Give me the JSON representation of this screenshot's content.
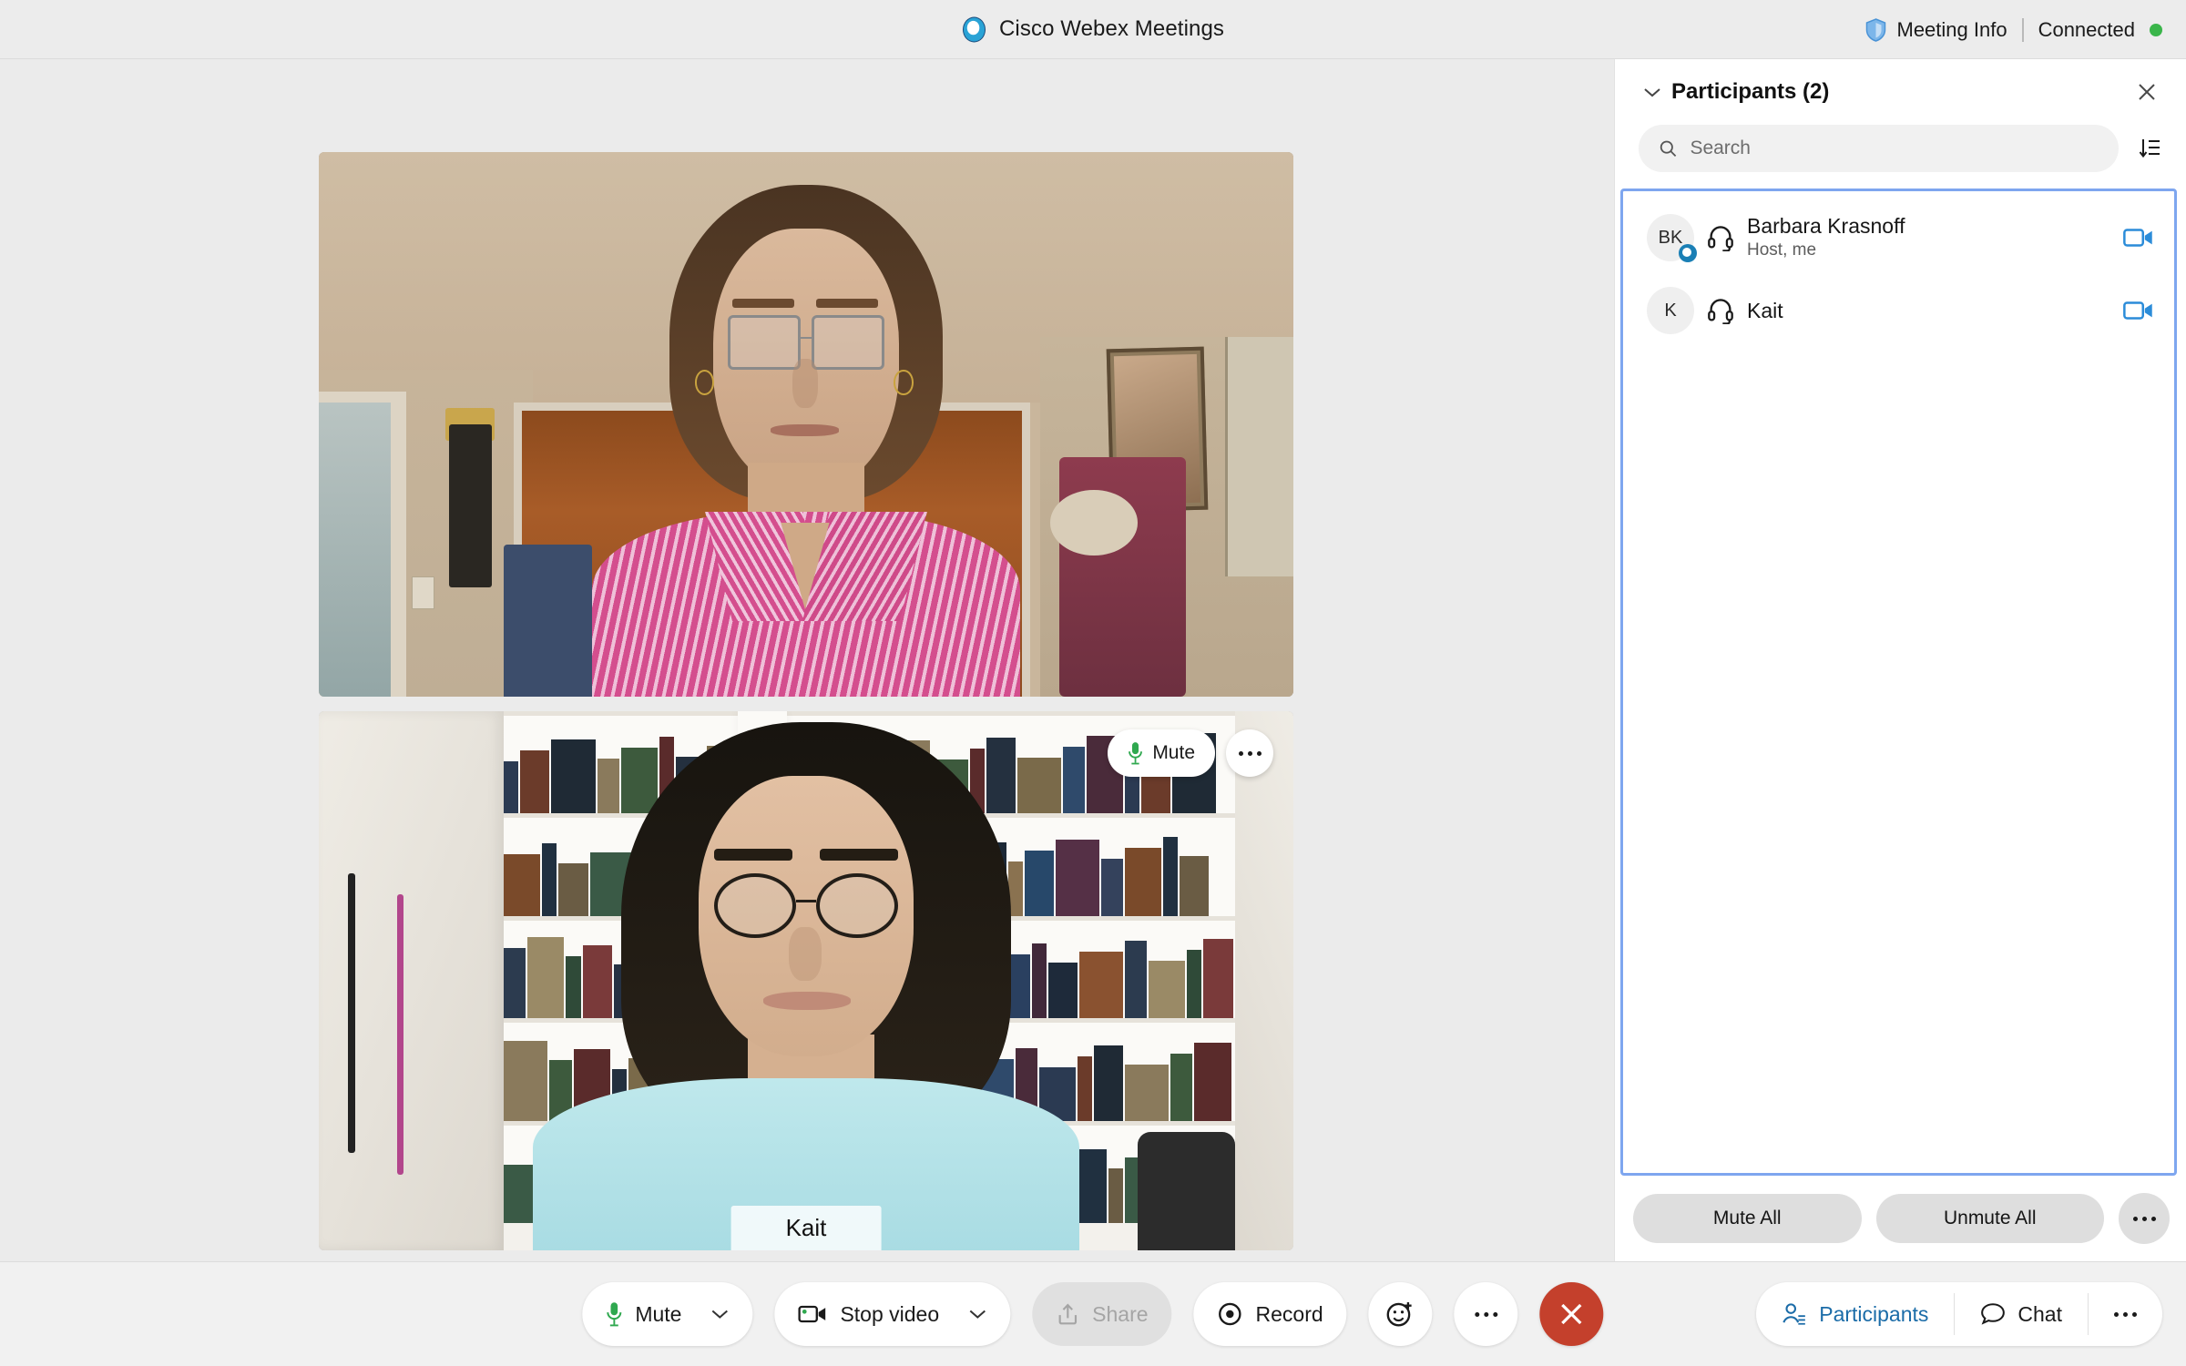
{
  "header": {
    "app_title": "Cisco Webex Meetings",
    "logo_icon": "webex-logo-icon",
    "meeting_info_label": "Meeting Info",
    "meeting_info_icon": "shield-icon",
    "connection_status": "Connected",
    "status_color": "#3ab54a"
  },
  "stage": {
    "tiles": [
      {
        "participant": "Barbara Krasnoff",
        "name_label": "",
        "has_overlay_controls": false
      },
      {
        "participant": "Kait",
        "name_label": "Kait",
        "has_overlay_controls": true,
        "mute_label": "Mute",
        "mute_icon": "microphone-icon",
        "more_icon": "more-options-icon"
      }
    ]
  },
  "panel": {
    "title": "Participants (2)",
    "collapse_icon": "chevron-down-icon",
    "close_icon": "close-icon",
    "search": {
      "placeholder": "Search",
      "value": "",
      "icon": "search-icon"
    },
    "sort_icon": "sort-icon",
    "accent_border_color": "#7ea6ef",
    "participants": [
      {
        "initials": "BK",
        "name": "Barbara Krasnoff",
        "role": "Host, me",
        "audio_icon": "headset-icon",
        "video_icon": "video-camera-icon",
        "badge_icon": "webex-status-badge-icon"
      },
      {
        "initials": "K",
        "name": "Kait",
        "role": "",
        "audio_icon": "headset-icon",
        "video_icon": "video-camera-icon",
        "badge_icon": ""
      }
    ],
    "footer": {
      "mute_all_label": "Mute All",
      "unmute_all_label": "Unmute All",
      "more_icon": "more-options-icon"
    }
  },
  "toolbar": {
    "mute_label": "Mute",
    "mute_icon": "microphone-icon",
    "mute_caret_icon": "chevron-down-icon",
    "stop_video_label": "Stop video",
    "stop_video_icon": "video-camera-icon",
    "stop_video_caret_icon": "chevron-down-icon",
    "share_label": "Share",
    "share_icon": "share-upload-icon",
    "share_disabled": true,
    "record_label": "Record",
    "record_icon": "record-circle-icon",
    "reaction_icon": "reaction-smiley-icon",
    "more_icon": "more-options-icon",
    "leave_icon": "close-icon",
    "leave_color": "#c4402c",
    "participants_label": "Participants",
    "participants_icon": "participants-person-icon",
    "participants_active_color": "#1b6ca8",
    "chat_label": "Chat",
    "chat_icon": "chat-bubble-icon",
    "right_more_icon": "more-options-icon"
  }
}
